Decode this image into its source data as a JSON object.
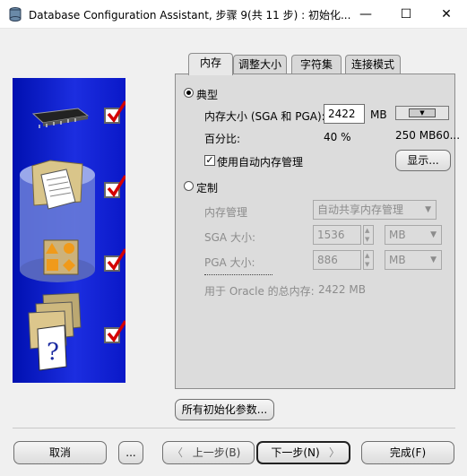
{
  "window": {
    "title": "Database Configuration Assistant, 步骤 9(共 11 步) : 初始化...",
    "minimize_glyph": "—",
    "maximize_glyph": "☐",
    "close_glyph": "✕"
  },
  "tabs": [
    {
      "label": "内存"
    },
    {
      "label": "调整大小"
    },
    {
      "label": "字符集"
    },
    {
      "label": "连接模式"
    }
  ],
  "typical": {
    "label": "典型",
    "memory_size_label": "内存大小 (SGA 和 PGA):",
    "memory_size_value": "2422",
    "memory_unit": "MB",
    "percent_label": "百分比:",
    "percent_value": "40 %",
    "slider_range": "250 MB60...",
    "auto_memory_label": "使用自动内存管理",
    "auto_memory_checked": true,
    "show_button": "显示..."
  },
  "custom": {
    "label": "定制",
    "memory_mgmt_label": "内存管理",
    "memory_mgmt_value": "自动共享内存管理",
    "sga_label": "SGA 大小:",
    "sga_value": "1536",
    "sga_unit": "MB",
    "pga_label": "PGA 大小:",
    "pga_value": "886",
    "pga_unit": "MB",
    "total_label": "用于 Oracle 的总内存:",
    "total_value": "2422 MB"
  },
  "all_params_button": "所有初始化参数...",
  "footer": {
    "cancel": "取消",
    "help": "...",
    "back": "上一步(B)",
    "next": "下一步(N)",
    "finish": "完成(F)"
  },
  "colors": {
    "panel_blue": "#1c2ee0",
    "check_red": "#d40000"
  }
}
